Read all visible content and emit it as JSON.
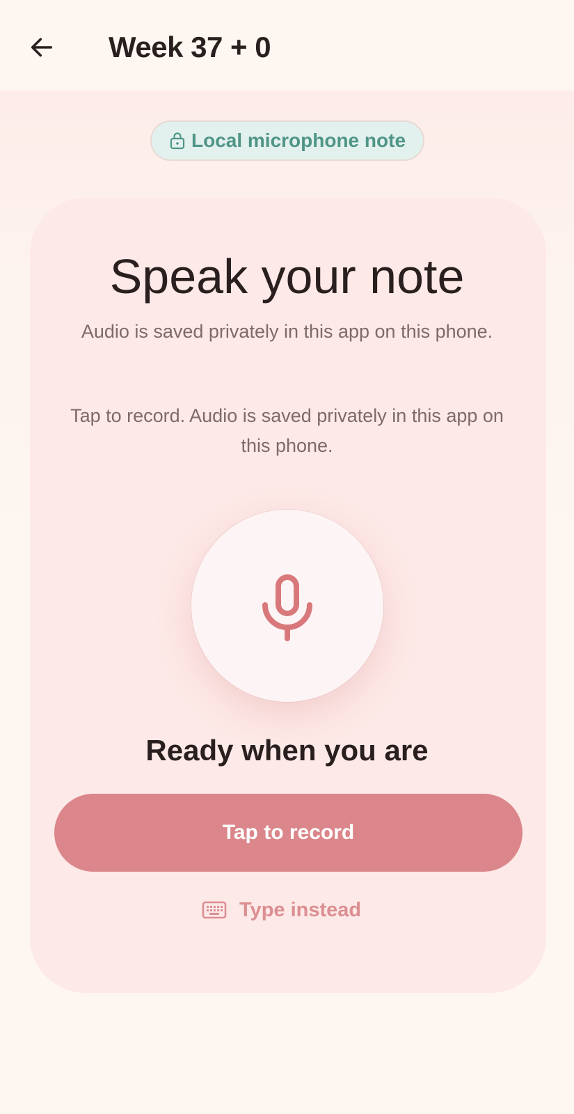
{
  "header": {
    "back_icon": "arrow-left-icon",
    "title": "Week 37 + 0"
  },
  "badge": {
    "icon": "lock-icon",
    "label": "Local microphone note"
  },
  "card": {
    "title": "Speak your note",
    "subtitle_1": "Audio is saved privately in this app on this phone.",
    "subtitle_2": "Tap to record. Audio is saved privately in this app on this phone.",
    "mic_icon": "microphone-icon",
    "status": "Ready when you are",
    "record_button": "Tap to record",
    "type_instead_icon": "keyboard-icon",
    "type_instead_label": "Type instead"
  },
  "colors": {
    "background": "#fdf6f1",
    "card_background": "#fde9e7",
    "accent": "#db868a",
    "badge_background": "#e3f1ee",
    "badge_text": "#4f9587",
    "text_primary": "#2a1f1f",
    "text_secondary": "#7d6b69"
  }
}
